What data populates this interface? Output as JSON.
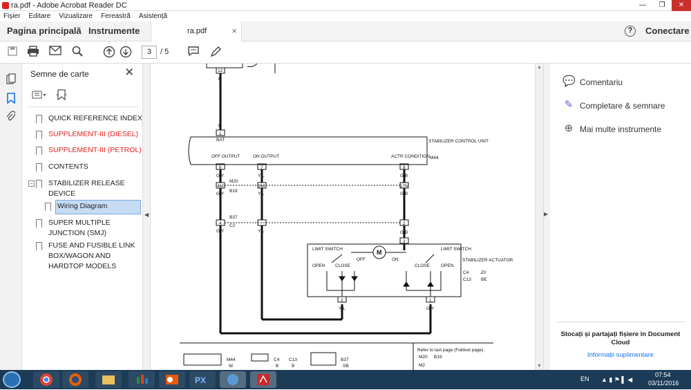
{
  "window": {
    "title": "ra.pdf - Adobe Acrobat Reader DC",
    "min": "—",
    "max": "❐",
    "close": "✕"
  },
  "menu": [
    "Fișier",
    "Editare",
    "Vizualizare",
    "Fereastră",
    "Asistență"
  ],
  "tabs": {
    "home": "Pagina principală",
    "tools": "Instrumente",
    "doc": "ra.pdf",
    "doc_close": "×",
    "help": "?",
    "login": "Conectare"
  },
  "toolbar": {
    "page": "3",
    "total": "/ 5"
  },
  "bookmarks": {
    "title": "Semne de carte",
    "items": [
      {
        "label": "QUICK REFERENCE INDEX",
        "color": "#333"
      },
      {
        "label": "SUPPLEMENT-III (DIESEL)",
        "color": "#e02020"
      },
      {
        "label": "SUPPLEMENT-III (PETROL)",
        "color": "#e02020"
      },
      {
        "label": "CONTENTS",
        "color": "#333"
      },
      {
        "label": "STABILIZER RELEASE DEVICE",
        "color": "#333"
      },
      {
        "label": "Wiring Diagram",
        "color": "#333",
        "selected": true
      },
      {
        "label": "SUPER MULTIPLE JUNCTION (SMJ)",
        "color": "#333"
      },
      {
        "label": "FUSE AND FUSIBLE LINK BOX/WAGON AND HARDTOP MODELS",
        "color": "#333"
      }
    ]
  },
  "right": {
    "comment": "Comentariu",
    "fill": "Completare & semnare",
    "more": "Mai multe instrumente",
    "promo": "Stocați și partajați fișiere în Document Cloud",
    "info": "Informații suplimentare"
  },
  "diagram": {
    "bat_wire": "R",
    "bat": "BAT",
    "unit": "STABILIZER CONTROL UNIT",
    "unit_conn": "M44",
    "off_out": "OFF OUTPUT",
    "on_out": "ON OUTPUT",
    "actr": "ACTR CONDITION",
    "pin6": "6",
    "pin7": "7",
    "pin8": "8",
    "pin12": "12",
    "pin1": "1",
    "w_gy": "G/Y",
    "w_yl": "Y/L",
    "w_gb": "G/B",
    "c_4m": "4M",
    "c_2m": "2M",
    "c_17m": "17M",
    "c_m20": "M20",
    "c_b19": "B19",
    "c_b37": "B37",
    "c_c2": "C2",
    "p4": "4",
    "p2": "2",
    "p3": "3",
    "limit": "LIMIT SWITCH",
    "open": "OPEN",
    "close": "CLOSE",
    "off": "OFF",
    "on": "ON",
    "motor": "M",
    "actuator": "STABILIZER ACTUATOR",
    "c_c4": "C4",
    "c_c13": "C13",
    "z0": "Z0",
    "be": "BE",
    "ft_m44": "M44",
    "ft_w": "W",
    "ft_c4": "C4",
    "ft_b": "B",
    "ft_c13": "C13",
    "ft_b2": "B",
    "ft_b37": "B37",
    "ft_sb": "SB",
    "refer": "Refer to last page (Foldout page).",
    "ref_m20": "M20",
    "ref_b19": "B19",
    "ref_m2": "M2"
  },
  "tray": {
    "lang": "EN",
    "time": "07:54",
    "date": "03/11/2016"
  }
}
